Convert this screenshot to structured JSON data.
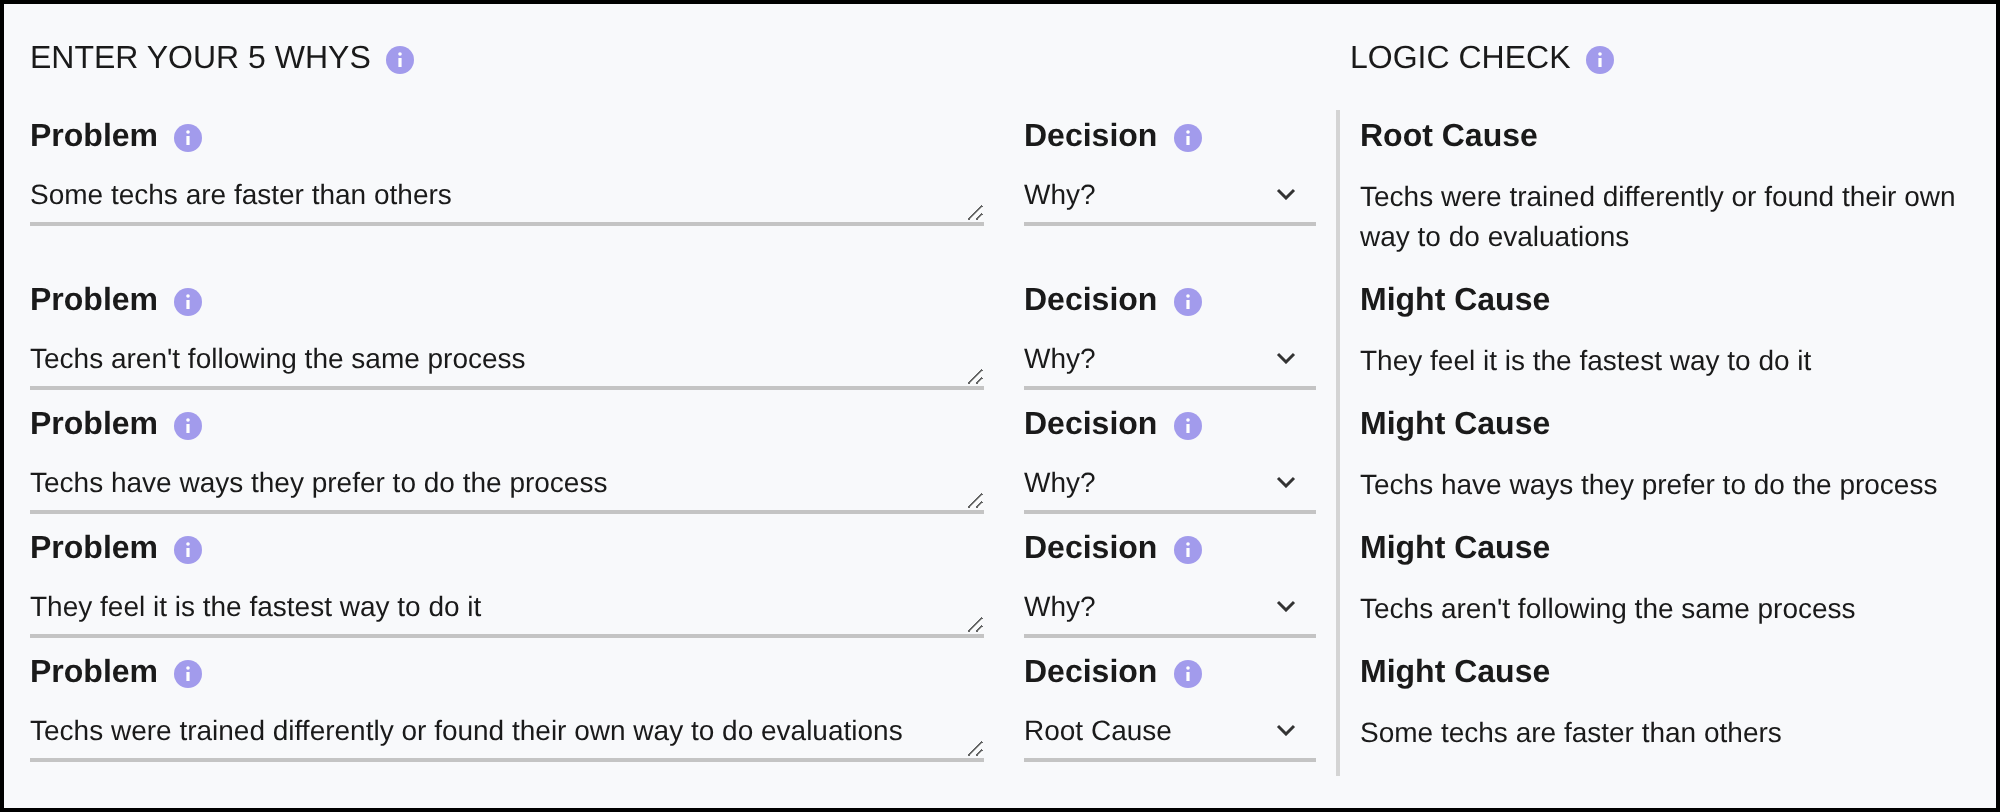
{
  "whys_heading": "ENTER YOUR 5 WHYS",
  "logic_heading": "LOGIC CHECK",
  "rows": [
    {
      "problem_label": "Problem",
      "problem_value": "Some techs are faster than others",
      "decision_label": "Decision",
      "decision_value": "Why?",
      "logic_label": "Root Cause",
      "logic_text": "Techs were trained differently or found their own way to do evaluations"
    },
    {
      "problem_label": "Problem",
      "problem_value": "Techs aren't following the same process",
      "decision_label": "Decision",
      "decision_value": "Why?",
      "logic_label": "Might Cause",
      "logic_text": "They feel it is the fastest way to do it"
    },
    {
      "problem_label": "Problem",
      "problem_value": "Techs have ways they prefer to do the process",
      "decision_label": "Decision",
      "decision_value": "Why?",
      "logic_label": "Might Cause",
      "logic_text": "Techs have ways they prefer to do the process"
    },
    {
      "problem_label": "Problem",
      "problem_value": "They feel it is the fastest way to do it",
      "decision_label": "Decision",
      "decision_value": "Why?",
      "logic_label": "Might Cause",
      "logic_text": "Techs aren't following the same process"
    },
    {
      "problem_label": "Problem",
      "problem_value": "Techs were trained differently or found their own way to do evaluations",
      "decision_label": "Decision",
      "decision_value": "Root Cause",
      "logic_label": "Might Cause",
      "logic_text": "Some techs are faster than others"
    }
  ]
}
